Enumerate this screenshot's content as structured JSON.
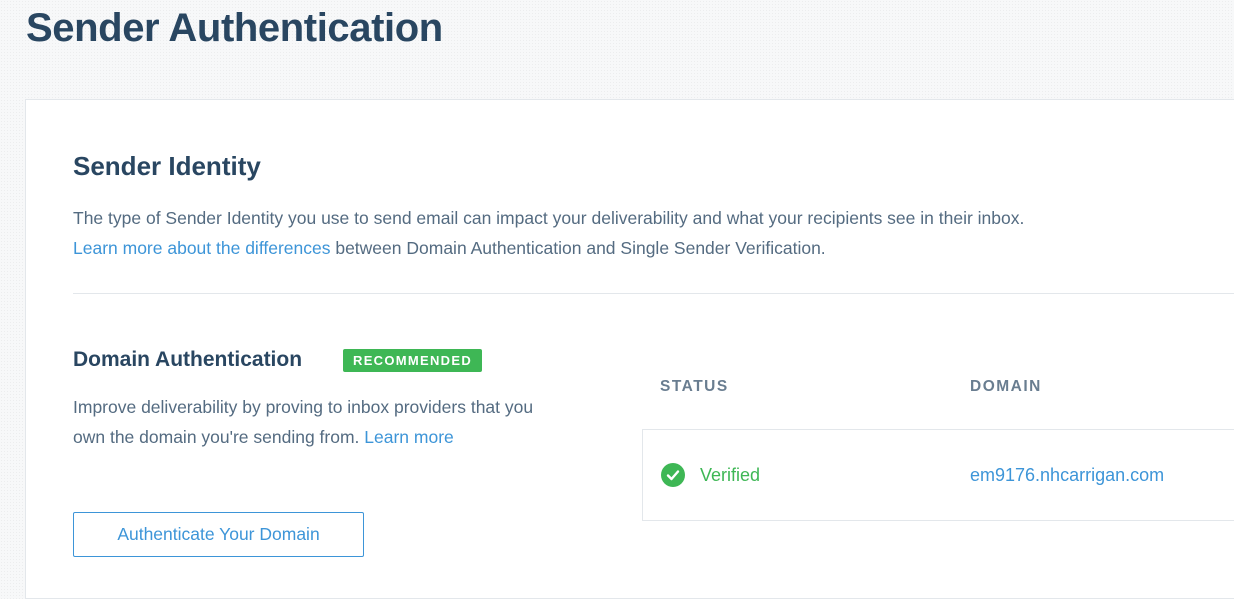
{
  "page": {
    "title": "Sender Authentication"
  },
  "sender_identity": {
    "title": "Sender Identity",
    "description_line1": "The type of Sender Identity you use to send email can impact your deliverability and what your recipients see in their inbox.",
    "learn_more_link": "Learn more about the differences",
    "description_line2_rest": " between Domain Authentication and Single Sender Verification."
  },
  "domain_authentication": {
    "title": "Domain Authentication",
    "badge": "RECOMMENDED",
    "description": "Improve deliverability by proving to inbox providers that you own the domain you're sending from. ",
    "learn_more_link": "Learn more",
    "button_label": "Authenticate Your Domain"
  },
  "domains_table": {
    "columns": [
      "STATUS",
      "DOMAIN"
    ],
    "rows": [
      {
        "status_icon": "check-circle-icon",
        "status": "Verified",
        "domain": "em9176.nhcarrigan.com"
      }
    ]
  },
  "colors": {
    "heading": "#294661",
    "body_text": "#546b81",
    "link": "#3d95d8",
    "success": "#3eb755",
    "border": "#e3e7eb"
  }
}
